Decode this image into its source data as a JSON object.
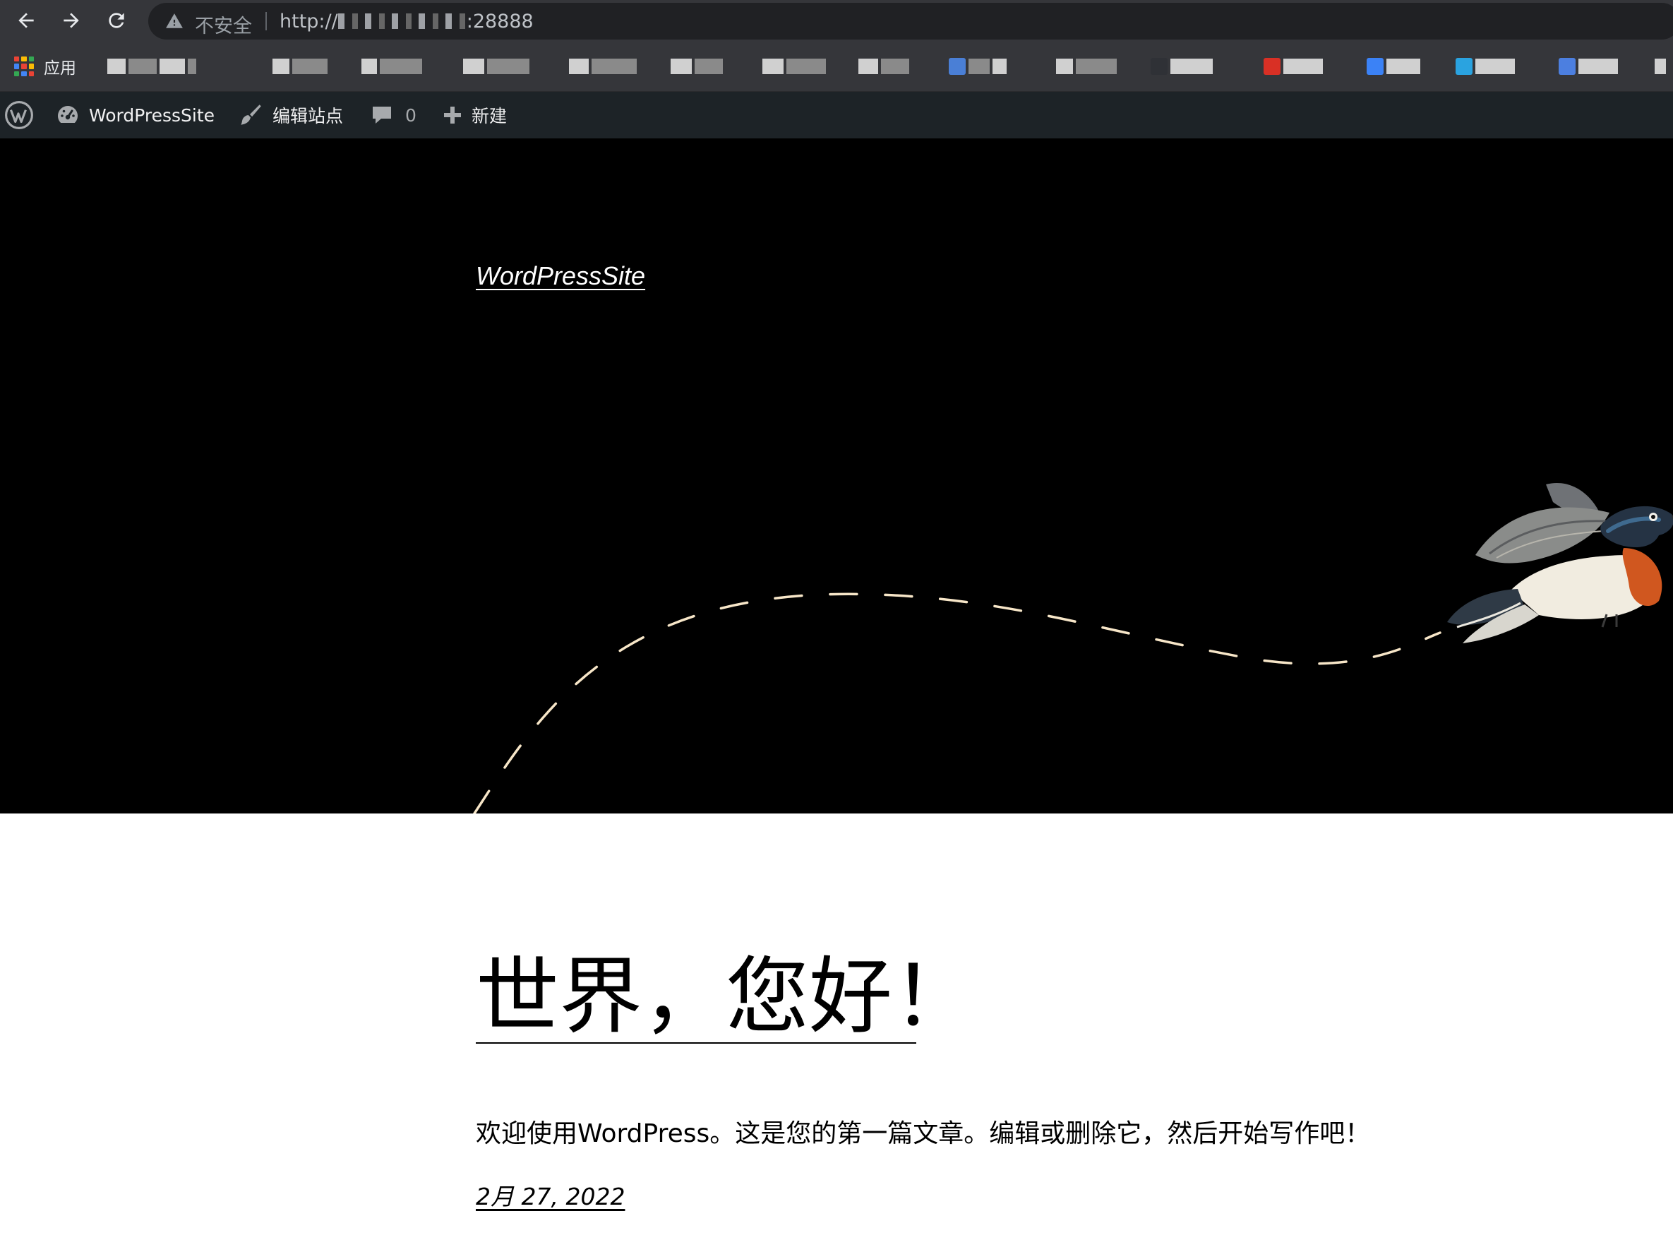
{
  "browser": {
    "security_label": "不安全",
    "url_prefix": "http://",
    "url_port": ":28888",
    "bookmarks_apps_label": "应用"
  },
  "admin_bar": {
    "site_name": "WordPressSite",
    "edit_site": "编辑站点",
    "comments_count": "0",
    "new_label": "新建"
  },
  "site": {
    "title": "WordPressSite"
  },
  "post": {
    "title": "世界，您好！",
    "excerpt": "欢迎使用WordPress。这是您的第一篇文章。编辑或删除它，然后开始写作吧！",
    "date": "2月 27, 2022"
  },
  "colors": {
    "chrome_bg": "#35363a",
    "omnibox_bg": "#202124",
    "admin_bar_bg": "#1d2327",
    "hero_bg": "#000000",
    "path_dash": "#f7e6c8"
  }
}
